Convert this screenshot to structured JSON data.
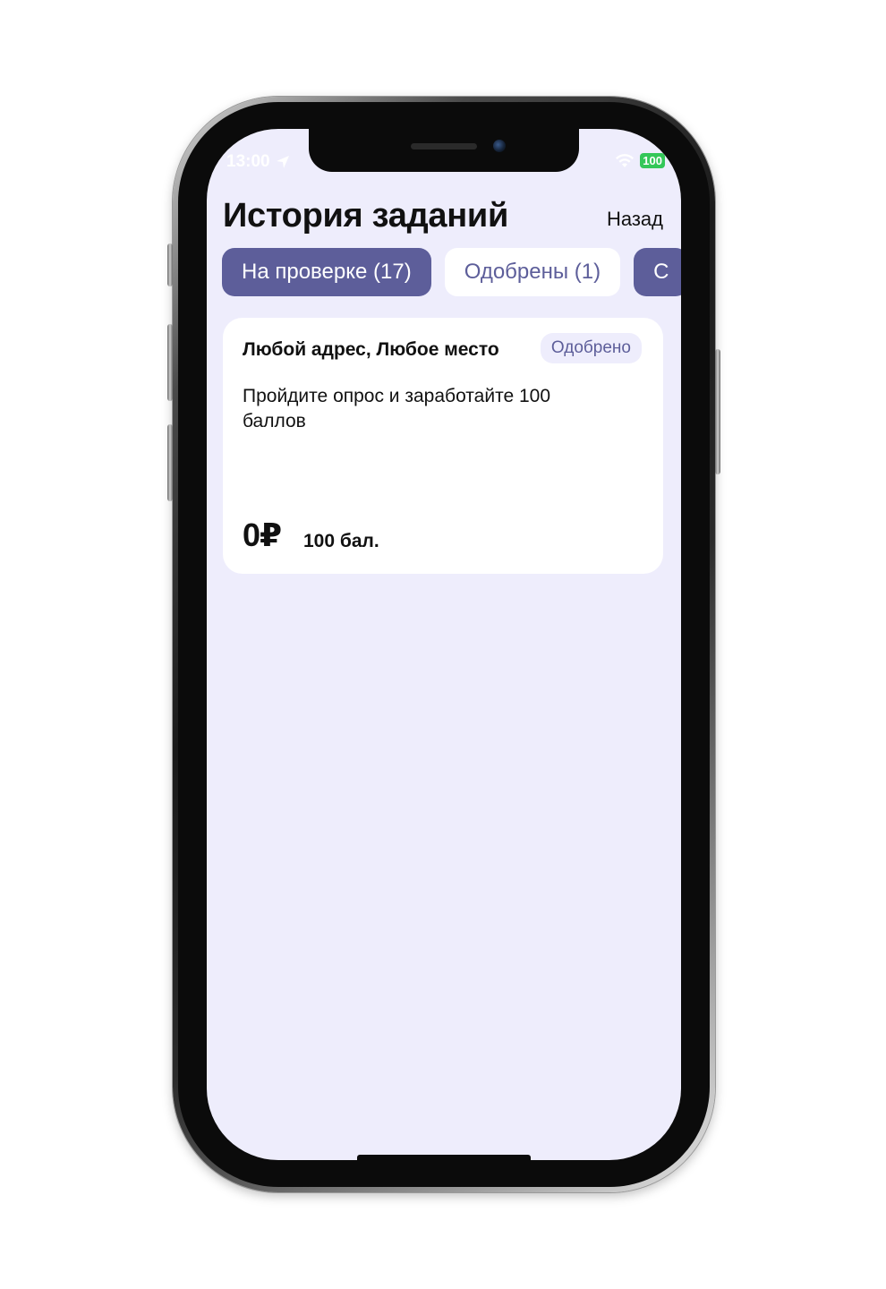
{
  "status_bar": {
    "time": "13:00",
    "battery": "100"
  },
  "header": {
    "title": "История заданий",
    "back_label": "Назад"
  },
  "tabs": [
    {
      "label": "На проверке (17)",
      "active": true
    },
    {
      "label": "Одобрены (1)",
      "active": false
    },
    {
      "label": "С",
      "active": false
    }
  ],
  "card": {
    "title": "Любой адрес, Любое место",
    "badge": "Одобрено",
    "description": "Пройдите опрос и заработайте 100 баллов",
    "money": "0₽",
    "points": "100 бал."
  },
  "colors": {
    "accent": "#5d5e9a",
    "screen_background": "#eeedfc",
    "card_background": "#ffffff",
    "battery": "#34c759"
  },
  "icons": [
    "location-arrow-icon",
    "wifi-icon",
    "battery-icon"
  ]
}
